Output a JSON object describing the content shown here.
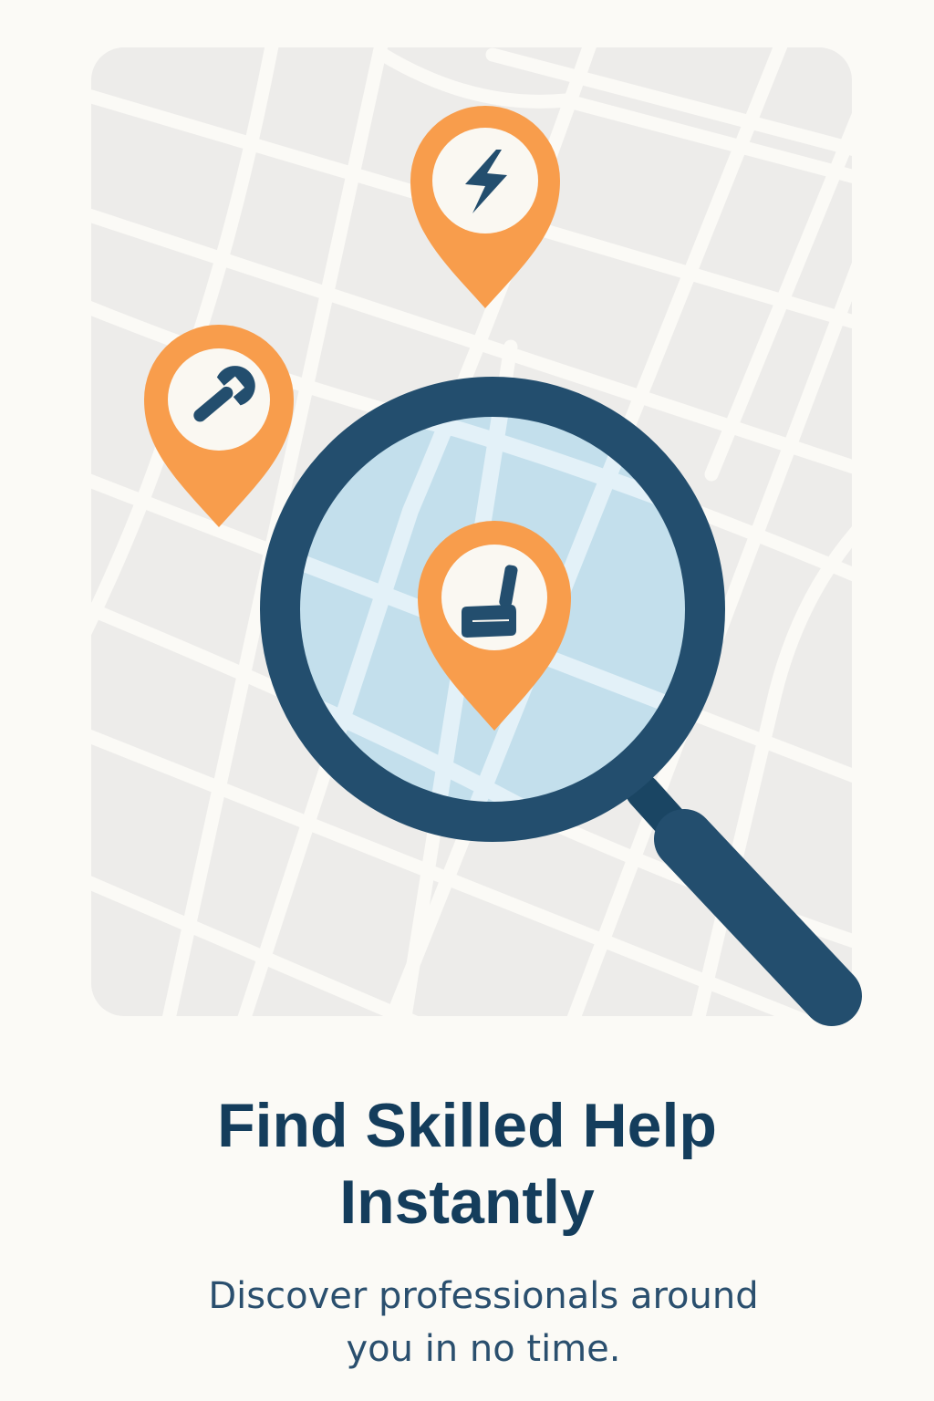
{
  "onboarding": {
    "title_line1": "Find Skilled Help",
    "title_line2": "Instantly",
    "subtitle_line1": "Discover professionals around",
    "subtitle_line2": "you in no time."
  },
  "colors": {
    "background": "#fbfaf6",
    "map_background": "#edecea",
    "map_streets": "#fbfaf6",
    "pin_orange": "#f89d4c",
    "brand_navy": "#234e6e",
    "lens_fill": "#c3dfec",
    "title_color": "#143d5c"
  },
  "pins": [
    {
      "service": "electrician",
      "icon": "lightning-bolt-icon"
    },
    {
      "service": "plumber",
      "icon": "wrench-icon"
    },
    {
      "service": "cleaner",
      "icon": "brush-icon"
    }
  ]
}
